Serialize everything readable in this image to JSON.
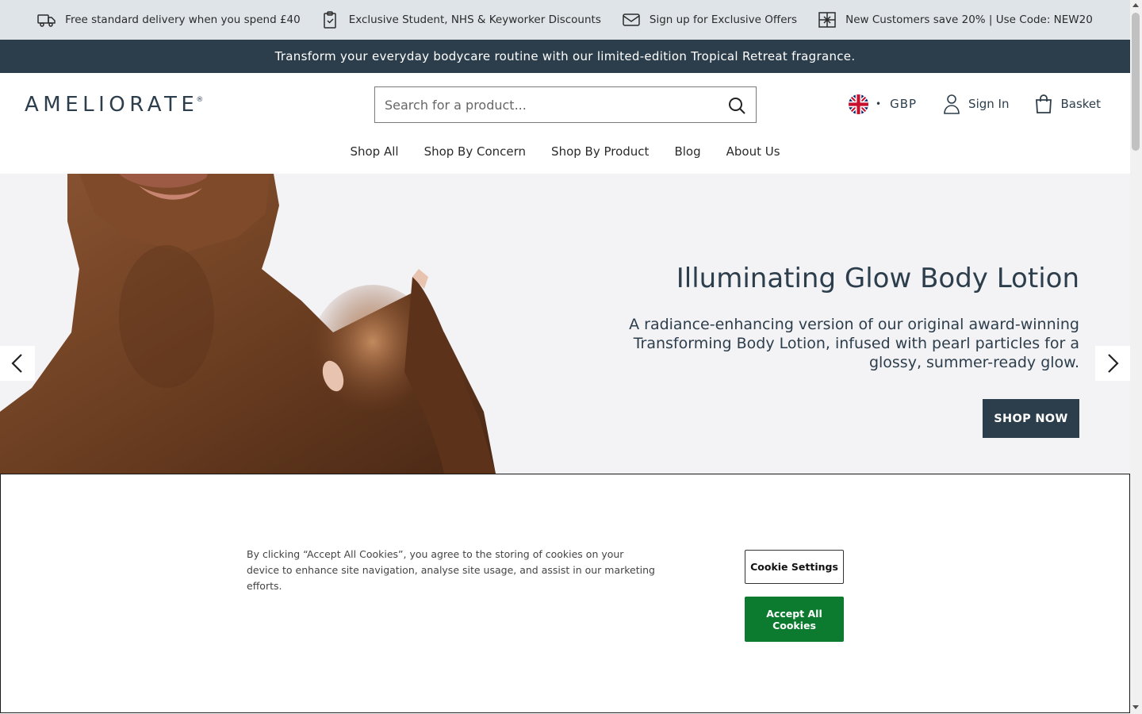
{
  "usp_bar": {
    "items": [
      {
        "icon": "delivery-truck-icon",
        "text": "Free standard delivery when you spend £40"
      },
      {
        "icon": "clipboard-check-icon",
        "text": "Exclusive Student, NHS & Keyworker Discounts"
      },
      {
        "icon": "envelope-icon",
        "text": "Sign up for Exclusive Offers"
      },
      {
        "icon": "gift-icon",
        "text": "New Customers save 20% | Use Code: NEW20"
      }
    ]
  },
  "promo_bar": {
    "text": "Transform your everyday bodycare routine with our limited-edition Tropical Retreat fragrance."
  },
  "header": {
    "logo": "AMELIORATE",
    "logo_mark": "®",
    "search_placeholder": "Search for a product...",
    "currency_dot": "•",
    "currency": "GBP",
    "sign_in": "Sign In",
    "basket": "Basket"
  },
  "nav": {
    "items": [
      "Shop All",
      "Shop By Concern",
      "Shop By Product",
      "Blog",
      "About Us"
    ]
  },
  "hero": {
    "title": "Illuminating Glow Body Lotion",
    "description": "A radiance-enhancing version of our original award-winning Transforming Body Lotion, infused with pearl particles for a glossy, summer-ready glow.",
    "cta": "SHOP NOW"
  },
  "cookie_banner": {
    "text": "By clicking “Accept All Cookies”, you agree to the storing of cookies on your device to enhance site navigation, analyse site usage, and assist in our marketing efforts.",
    "settings_button": "Cookie Settings",
    "accept_button": "Accept All Cookies"
  },
  "colors": {
    "brand_dark": "#2c3e4c",
    "usp_bg": "#dfe4e8",
    "hero_bg": "#f3f2f5",
    "accept_green": "#0c7a2f"
  }
}
